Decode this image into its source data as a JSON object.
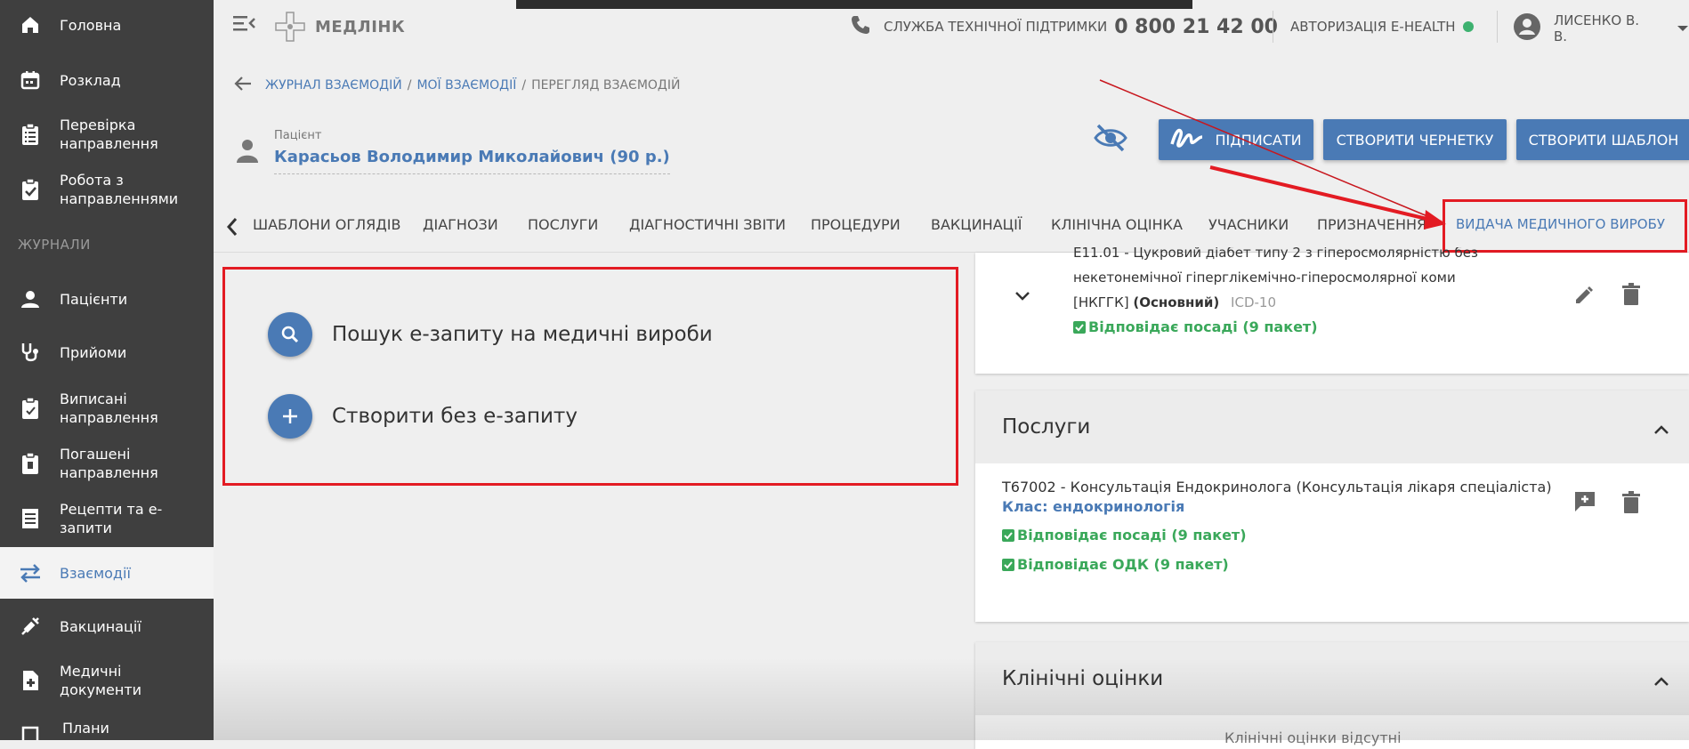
{
  "sidebar": {
    "items": [
      {
        "label": "Головна"
      },
      {
        "label": "Розклад"
      },
      {
        "label": "Перевірка направлення"
      },
      {
        "label": "Робота з направленнями"
      },
      {
        "label": "Пацієнти"
      },
      {
        "label": "Прийоми"
      },
      {
        "label": "Виписані направлення"
      },
      {
        "label": "Погашені направлення"
      },
      {
        "label": "Рецепти та е-запити"
      },
      {
        "label": "Взаємодії"
      },
      {
        "label": "Вакцинації"
      },
      {
        "label": "Медичні документи"
      },
      {
        "label": "Плани"
      }
    ],
    "section_label": "ЖУРНАЛИ",
    "active": "Взаємодії"
  },
  "header": {
    "logo_text": "МЕДЛІНК",
    "support_label": "СЛУЖБА ТЕХНІЧНОЇ ПІДТРИМКИ",
    "support_phone": "0 800 21 42 00",
    "ehealth_label": "АВТОРИЗАЦІЯ E-HEALTH",
    "ehealth_status_color": "#3db16f",
    "user_name": "ЛИСЕНКО В. В."
  },
  "breadcrumb": [
    {
      "label": "ЖУРНАЛ ВЗАЄМОДІЙ"
    },
    {
      "label": "МОЇ ВЗАЄМОДІЇ"
    },
    {
      "label": "ПЕРЕГЛЯД ВЗАЄМОДІЙ"
    }
  ],
  "patient": {
    "label": "Пацієнт",
    "name": "Карасьов Володимир Миколайович (90 р.)"
  },
  "actions": {
    "sign": "ПІДПИСАТИ",
    "draft": "СТВОРИТИ ЧЕРНЕТКУ",
    "template": "СТВОРИТИ ШАБЛОН"
  },
  "tabs": [
    {
      "label": "ШАБЛОНИ ОГЛЯДІВ"
    },
    {
      "label": "ДІАГНОЗИ"
    },
    {
      "label": "ПОСЛУГИ"
    },
    {
      "label": "ДІАГНОСТИЧНІ ЗВІТИ"
    },
    {
      "label": "ПРОЦЕДУРИ"
    },
    {
      "label": "ВАКЦИНАЦІЇ"
    },
    {
      "label": "КЛІНІЧНА ОЦІНКА"
    },
    {
      "label": "УЧАСНИКИ"
    },
    {
      "label": "ПРИЗНАЧЕННЯ"
    },
    {
      "label": "ВИДАЧА МЕДИЧНОГО ВИРОБУ"
    }
  ],
  "device_options": [
    {
      "label": "Пошук е-запиту на медичні вироби"
    },
    {
      "label": "Створити без е-запиту"
    }
  ],
  "diagnosis": {
    "line1": "E11.01 - Цукровий діабет типу 2 з гіперосмолярністю без",
    "line2": "некетонемічної гіперглікемічно-гіперосмолярної коми",
    "line3_prefix": "[НКГГК]",
    "line3_bold": "(Основний)",
    "line3_code": "ICD-10",
    "status": "Відповідає посаді (9 пакет)"
  },
  "services": {
    "title": "Послуги",
    "item": "T67002 - Консультація Ендокринолога (Консультація лікаря спеціаліста)",
    "class_label": "Клас: ендокринологія",
    "status1": "Відповідає посаді (9 пакет)",
    "status2": "Відповідає ОДК (9 пакет)"
  },
  "clinical": {
    "title": "Клінічні оцінки",
    "partial_text": "Клінічні оцінки відсутні"
  },
  "colors": {
    "accent": "#4a7ab5",
    "highlight": "#e31b23",
    "success": "#3aa85a"
  }
}
